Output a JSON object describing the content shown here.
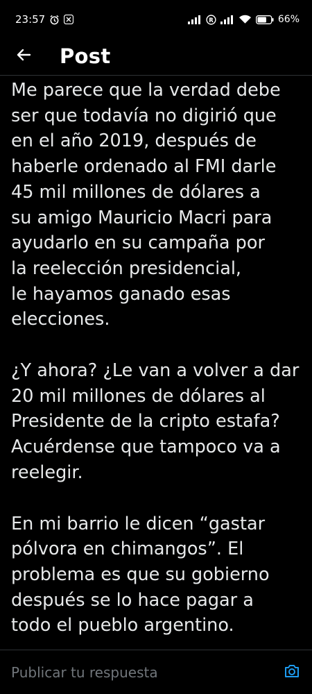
{
  "status_bar": {
    "time": "23:57",
    "battery": "66"
  },
  "header": {
    "title": "Post"
  },
  "post": {
    "paragraphs": [
      "Me parece que la verdad debe\nser que todavía no digirió que\nen el año 2019, después de\nhaberle ordenado al FMI darle\n45 mil millones de dólares a\nsu amigo Mauricio Macri para\nayudarlo en su campaña por\nla reelección presidencial,\nle hayamos ganado esas\nelecciones.",
      "¿Y ahora? ¿Le van a volver a dar\n20 mil millones de dólares al\nPresidente de la cripto estafa?\nAcuérdense que tampoco va a\nreelegir.",
      "En mi barrio le dicen “gastar\npólvora en chimangos”. El\nproblema es que su gobierno\ndespués se lo hace pagar a\ntodo el pueblo argentino."
    ]
  },
  "reply": {
    "placeholder": "Publicar tu respuesta"
  },
  "icons": {
    "back": "arrow-left-icon",
    "camera": "camera-icon",
    "alarm": "alarm-icon",
    "x_app": "x-app-icon",
    "signal": "signal-icon",
    "registered": "registered-icon",
    "wifi": "wifi-icon",
    "battery": "battery-icon"
  },
  "colors": {
    "background": "#000000",
    "text": "#e7e9ea",
    "muted": "#71767b",
    "accent": "#1d9bf0",
    "divider": "#2f3336"
  }
}
